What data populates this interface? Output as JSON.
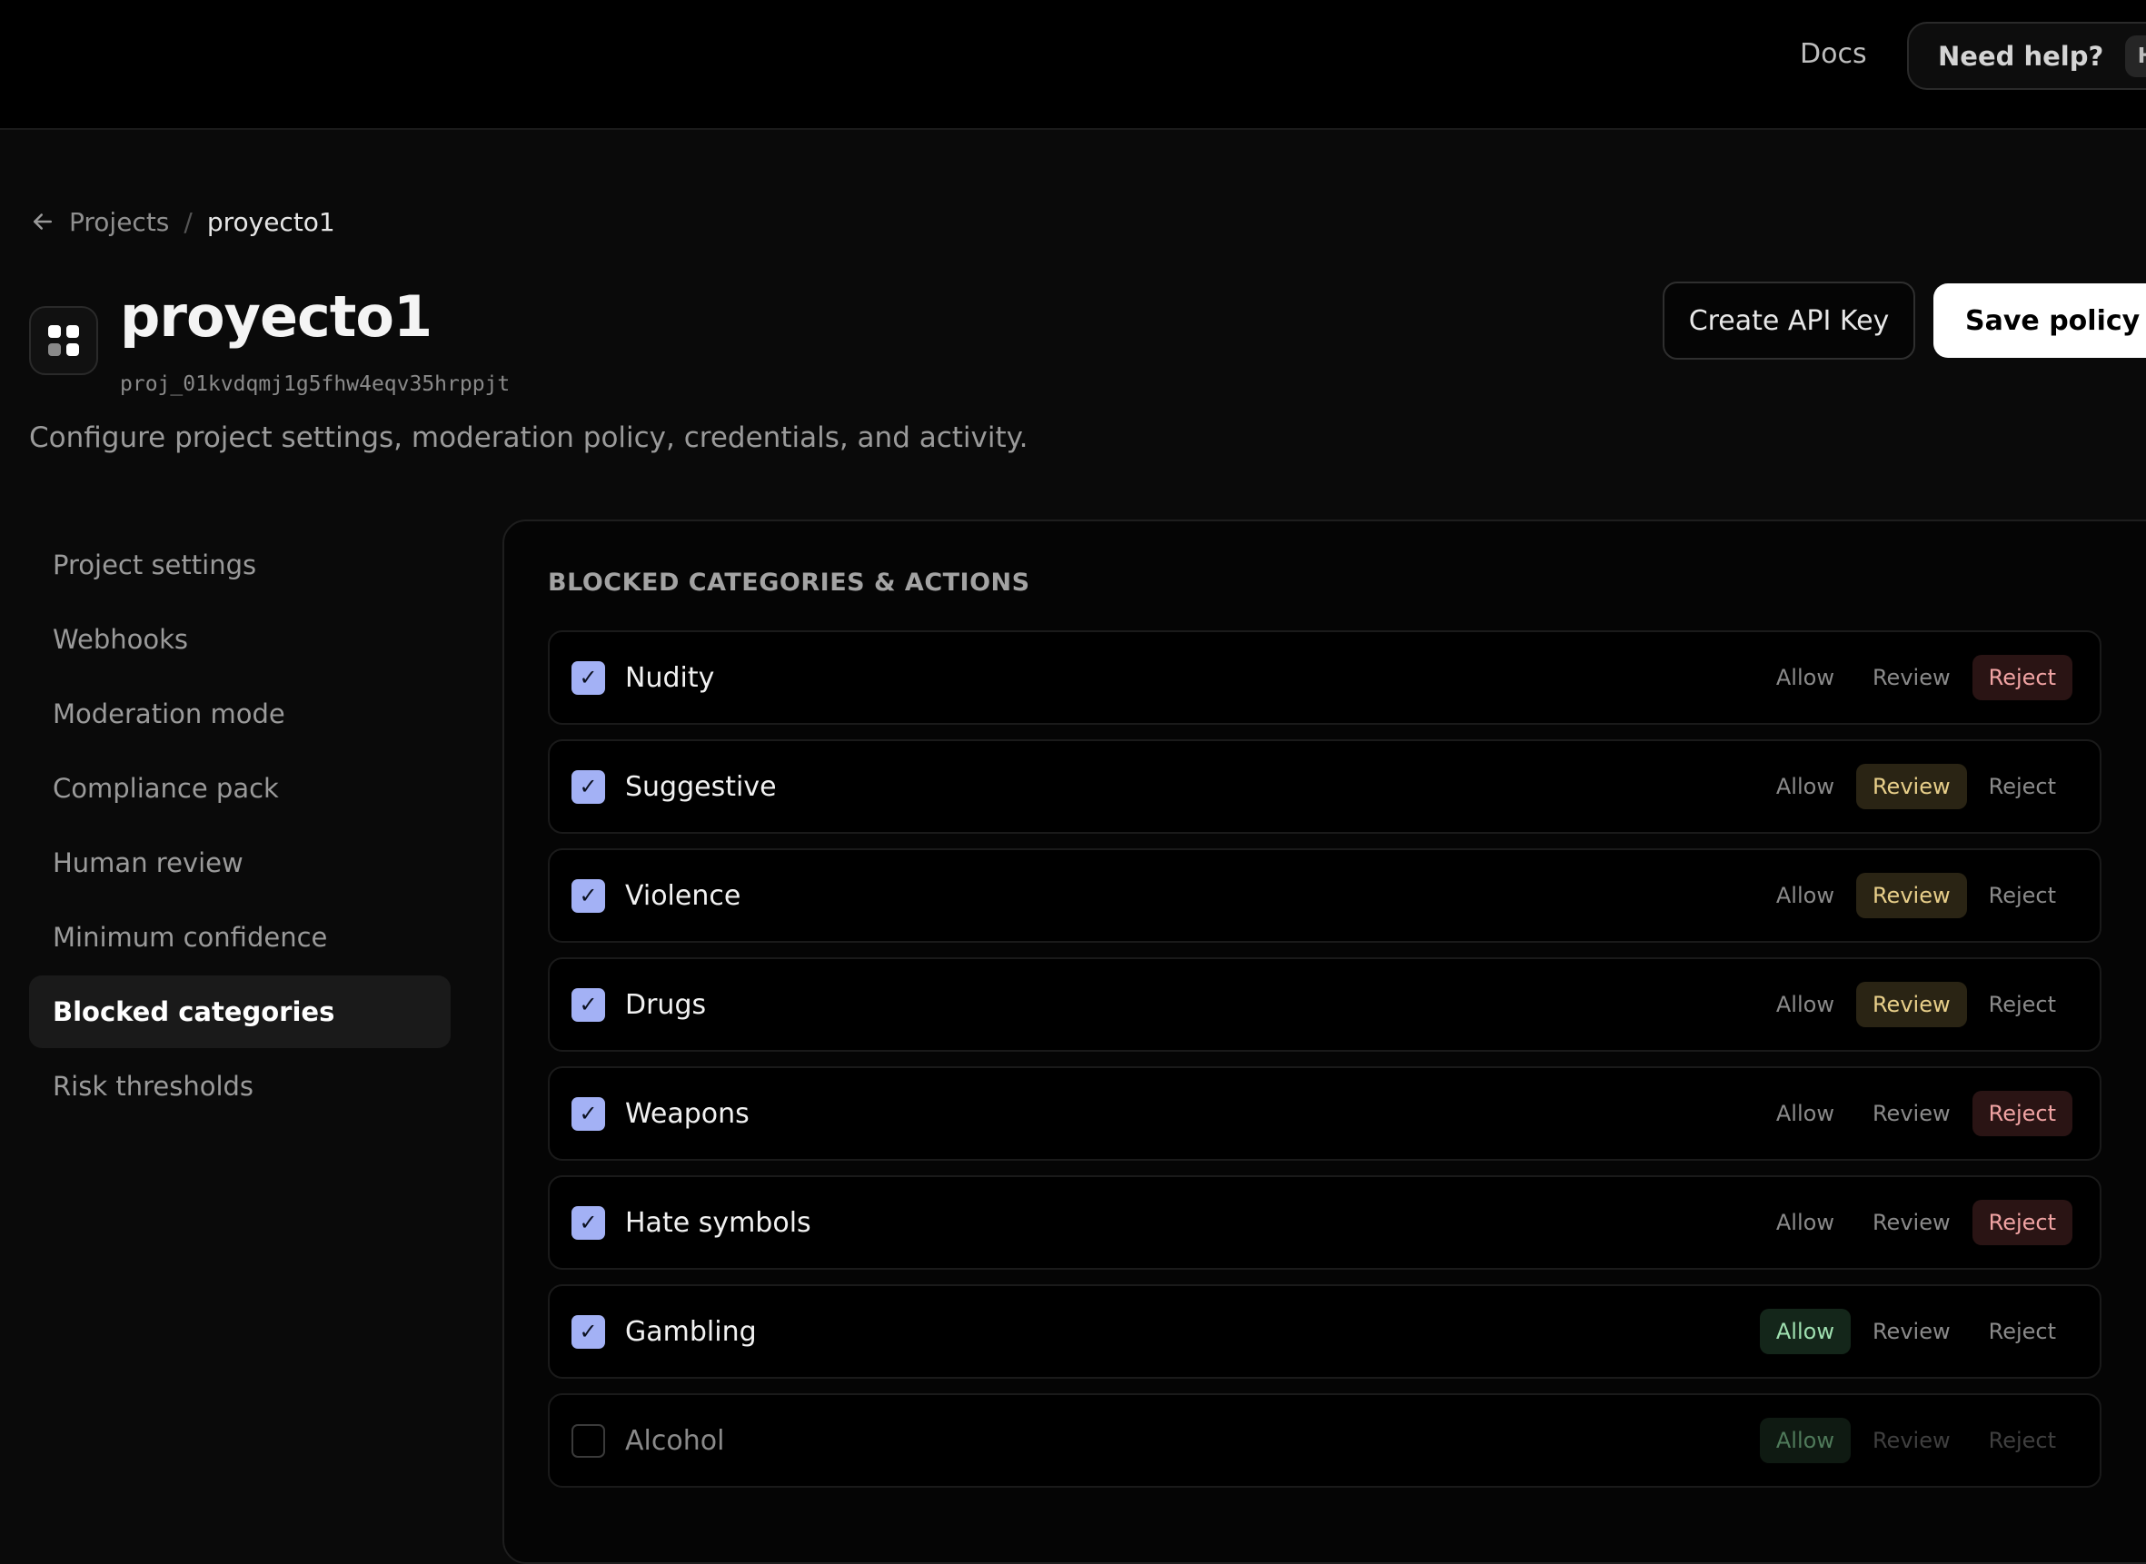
{
  "topbar": {
    "docs_label": "Docs",
    "help_label": "Need help?",
    "help_shortcut": "H"
  },
  "breadcrumb": {
    "parent": "Projects",
    "separator": "/",
    "current": "proyecto1"
  },
  "header": {
    "title": "proyecto1",
    "project_id": "proj_01kvdqmj1g5fhw4eqv35hrppjt",
    "description": "Configure project settings, moderation policy, credentials, and activity.",
    "create_api_key_label": "Create API Key",
    "save_policy_label": "Save policy"
  },
  "sidebar": {
    "items": [
      {
        "label": "Project settings",
        "active": false
      },
      {
        "label": "Webhooks",
        "active": false
      },
      {
        "label": "Moderation mode",
        "active": false
      },
      {
        "label": "Compliance pack",
        "active": false
      },
      {
        "label": "Human review",
        "active": false
      },
      {
        "label": "Minimum confidence",
        "active": false
      },
      {
        "label": "Blocked categories",
        "active": true
      },
      {
        "label": "Risk thresholds",
        "active": false
      }
    ]
  },
  "blocked": {
    "section_title": "BLOCKED CATEGORIES & ACTIONS",
    "action_labels": {
      "allow": "Allow",
      "review": "Review",
      "reject": "Reject"
    },
    "categories": [
      {
        "label": "Nudity",
        "checked": true,
        "action": "reject"
      },
      {
        "label": "Suggestive",
        "checked": true,
        "action": "review"
      },
      {
        "label": "Violence",
        "checked": true,
        "action": "review"
      },
      {
        "label": "Drugs",
        "checked": true,
        "action": "review"
      },
      {
        "label": "Weapons",
        "checked": true,
        "action": "reject"
      },
      {
        "label": "Hate symbols",
        "checked": true,
        "action": "reject"
      },
      {
        "label": "Gambling",
        "checked": true,
        "action": "allow"
      },
      {
        "label": "Alcohol",
        "checked": false,
        "action": "allow"
      }
    ]
  },
  "colors": {
    "checkbox": "#a3b1f5",
    "reject": "#f0a3a3",
    "review": "#e8cf8a",
    "allow": "#9fe0b0"
  }
}
